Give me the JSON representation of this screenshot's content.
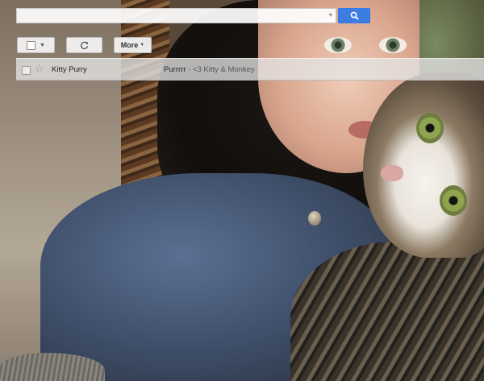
{
  "search": {
    "placeholder": "",
    "dropdown_icon": "caret-down-icon",
    "button_icon": "search-icon",
    "button_color": "#3b7de0"
  },
  "toolbar": {
    "select_icon": "checkbox-icon",
    "refresh_icon": "refresh-icon",
    "more_label": "More"
  },
  "inbox": {
    "rows": [
      {
        "sender": "Kitty Purry",
        "subject": "Purrrrr",
        "snippet": " - <3 Kitty & Monkey",
        "starred": false,
        "selected": false
      }
    ]
  }
}
